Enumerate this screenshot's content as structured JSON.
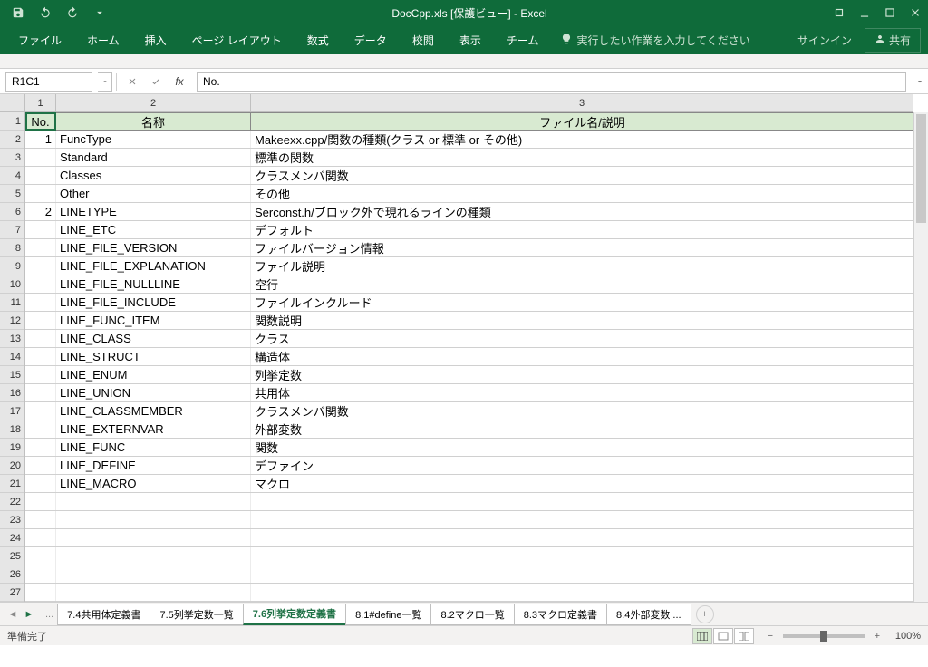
{
  "title": "DocCpp.xls [保護ビュー] - Excel",
  "qa": {
    "save": "保存",
    "undo": "元に戻す",
    "redo": "やり直し"
  },
  "win": {
    "restore": "元のサイズに戻す",
    "min": "最小化",
    "max": "最大化",
    "close": "閉じる"
  },
  "ribbon": {
    "file": "ファイル",
    "home": "ホーム",
    "insert": "挿入",
    "layout": "ページ レイアウト",
    "formulas": "数式",
    "data": "データ",
    "review": "校閲",
    "view": "表示",
    "team": "チーム",
    "tellme": "実行したい作業を入力してください",
    "signin": "サインイン",
    "share": "共有"
  },
  "namebox": "R1C1",
  "fx_value": "No.",
  "col_headers": [
    "1",
    "2",
    "3"
  ],
  "row_headers": [
    "1",
    "2",
    "3",
    "4",
    "5",
    "6",
    "7",
    "8",
    "9",
    "10",
    "11",
    "12",
    "13",
    "14",
    "15",
    "16",
    "17",
    "18",
    "19",
    "20",
    "21",
    "22",
    "23",
    "24",
    "25",
    "26",
    "27"
  ],
  "header_row": {
    "no": "No.",
    "name": "名称",
    "desc": "ファイル名/説明"
  },
  "rows": [
    {
      "no": "1",
      "name": "FuncType",
      "desc": "Makeexx.cpp/関数の種類(クラス or 標準 or その他)"
    },
    {
      "no": "",
      "name": "Standard",
      "desc": "標準の関数"
    },
    {
      "no": "",
      "name": "Classes",
      "desc": "クラスメンバ関数"
    },
    {
      "no": "",
      "name": "Other",
      "desc": "その他"
    },
    {
      "no": "2",
      "name": "LINETYPE",
      "desc": "Serconst.h/ブロック外で現れるラインの種類"
    },
    {
      "no": "",
      "name": "LINE_ETC",
      "desc": "デフォルト"
    },
    {
      "no": "",
      "name": "LINE_FILE_VERSION",
      "desc": "ファイルバージョン情報"
    },
    {
      "no": "",
      "name": "LINE_FILE_EXPLANATION",
      "desc": "ファイル説明"
    },
    {
      "no": "",
      "name": "LINE_FILE_NULLLINE",
      "desc": "空行"
    },
    {
      "no": "",
      "name": "LINE_FILE_INCLUDE",
      "desc": "ファイルインクルード"
    },
    {
      "no": "",
      "name": "LINE_FUNC_ITEM",
      "desc": "関数説明"
    },
    {
      "no": "",
      "name": "LINE_CLASS",
      "desc": "クラス"
    },
    {
      "no": "",
      "name": "LINE_STRUCT",
      "desc": "構造体"
    },
    {
      "no": "",
      "name": "LINE_ENUM",
      "desc": "列挙定数"
    },
    {
      "no": "",
      "name": "LINE_UNION",
      "desc": "共用体"
    },
    {
      "no": "",
      "name": "LINE_CLASSMEMBER",
      "desc": "クラスメンバ関数"
    },
    {
      "no": "",
      "name": "LINE_EXTERNVAR",
      "desc": "外部変数"
    },
    {
      "no": "",
      "name": "LINE_FUNC",
      "desc": "関数"
    },
    {
      "no": "",
      "name": "LINE_DEFINE",
      "desc": "デファイン"
    },
    {
      "no": "",
      "name": "LINE_MACRO",
      "desc": "マクロ"
    }
  ],
  "sheets": {
    "more": "...",
    "t1": "7.4共用体定義書",
    "t2": "7.5列挙定数一覧",
    "t3": "7.6列挙定数定義書",
    "t4": "8.1#define一覧",
    "t5": "8.2マクロ一覧",
    "t6": "8.3マクロ定義書",
    "t7": "8.4外部変数 ..."
  },
  "status": {
    "ready": "準備完了",
    "zoom": "100%"
  }
}
